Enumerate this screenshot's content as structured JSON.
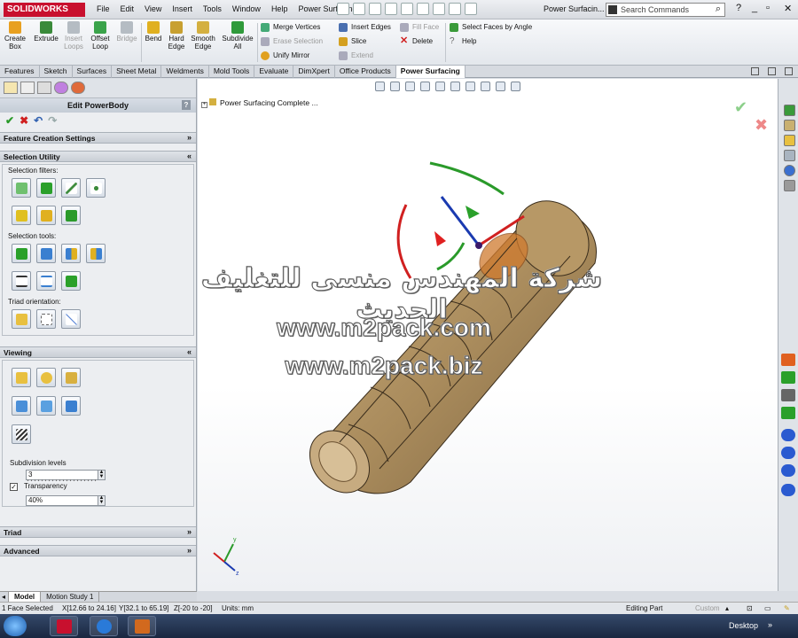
{
  "app": {
    "logo_text": "SOLIDWORKS",
    "document_title": "Power Surfacin..."
  },
  "menu": [
    "File",
    "Edit",
    "View",
    "Insert",
    "Tools",
    "Window",
    "Help",
    "Power Surfacing"
  ],
  "search": {
    "placeholder": "Search Commands"
  },
  "ribbon": {
    "large_buttons": [
      {
        "label1": "Create",
        "label2": "Box",
        "enabled": true,
        "color": "#e8a020"
      },
      {
        "label1": "Extrude",
        "label2": "",
        "enabled": true,
        "color": "#3a8a3a"
      },
      {
        "label1": "Insert",
        "label2": "Loops",
        "enabled": false,
        "color": "#9aa"
      },
      {
        "label1": "Offset",
        "label2": "Loop",
        "enabled": true,
        "color": "#3aa34a"
      },
      {
        "label1": "Bridge",
        "label2": "",
        "enabled": false,
        "color": "#9aa"
      },
      {
        "label1": "Bend",
        "label2": "",
        "enabled": true,
        "color": "#e0b020"
      },
      {
        "label1": "Hard",
        "label2": "Edge",
        "enabled": true,
        "color": "#c8a030"
      },
      {
        "label1": "Smooth",
        "label2": "Edge",
        "enabled": true,
        "color": "#d4b040"
      },
      {
        "label1": "Subdivide",
        "label2": "All",
        "enabled": true,
        "color": "#2f9a3a"
      }
    ],
    "small_buttons": [
      {
        "label": "Merge Vertices",
        "enabled": true,
        "color": "#4a7"
      },
      {
        "label": "Erase Selection",
        "enabled": false,
        "color": "#aab"
      },
      {
        "label": "Unify Mirror",
        "enabled": true,
        "color": "#e0a020"
      },
      {
        "label": "Insert Edges",
        "enabled": true,
        "color": "#4a6fb0"
      },
      {
        "label": "Slice",
        "enabled": true,
        "color": "#d4a020"
      },
      {
        "label": "Extend",
        "enabled": false,
        "color": "#aab"
      },
      {
        "label": "Fill Face",
        "enabled": false,
        "color": "#aab"
      },
      {
        "label": "Delete",
        "enabled": true,
        "color": "#d02020"
      },
      {
        "label": "Select Faces by Angle",
        "enabled": true,
        "color": "#3a9a3a"
      },
      {
        "label": "Help",
        "enabled": true,
        "color": "#888"
      }
    ]
  },
  "tabs": [
    {
      "label": "Features",
      "active": false
    },
    {
      "label": "Sketch",
      "active": false
    },
    {
      "label": "Surfaces",
      "active": false
    },
    {
      "label": "Sheet Metal",
      "active": false
    },
    {
      "label": "Weldments",
      "active": false
    },
    {
      "label": "Mold Tools",
      "active": false
    },
    {
      "label": "Evaluate",
      "active": false
    },
    {
      "label": "DimXpert",
      "active": false
    },
    {
      "label": "Office Products",
      "active": false
    },
    {
      "label": "Power Surfacing",
      "active": true
    }
  ],
  "property_manager": {
    "title": "Edit PowerBody",
    "help": "?",
    "ok": "✔",
    "cancel": "✖",
    "undo": "↶",
    "redo": "↷",
    "groups": {
      "feature_creation": {
        "title": "Feature Creation Settings",
        "chevron": "»"
      },
      "selection_utility": {
        "title": "Selection Utility",
        "chevron": "«",
        "filters_label": "Selection filters:",
        "tools_label": "Selection tools:",
        "triad_label": "Triad orientation:"
      },
      "viewing": {
        "title": "Viewing",
        "chevron": "«",
        "subdivision_label": "Subdivision levels",
        "subdivision_value": "3",
        "transparency_label": "Transparency",
        "transparency_checked": true,
        "transparency_value": "40%"
      },
      "triad": {
        "title": "Triad",
        "chevron": "»"
      },
      "advanced": {
        "title": "Advanced",
        "chevron": "»"
      }
    }
  },
  "viewport": {
    "tree_label": "Power Surfacing Complete ...",
    "confirm_ok": "✔",
    "confirm_cancel": "✖",
    "watermark": {
      "arabic": "شركة المهندس منسى للتغليف الحديث",
      "line1": "www.m2pack.com",
      "line2": "www.m2pack.biz"
    }
  },
  "model_tabs": [
    {
      "label": "Model",
      "active": true
    },
    {
      "label": "Motion Study 1",
      "active": false
    }
  ],
  "status_bar": {
    "selection": "1 Face Selected",
    "x_range": "X[12.66 to 24.16]",
    "y_range": "Y[32.1 to 65.19]",
    "z_range": "Z[-20 to -20]",
    "units": "Units: mm",
    "mode": "Editing Part",
    "custom": "Custom"
  },
  "taskbar": {
    "desktop": "Desktop"
  },
  "triad_axes": {
    "x": "x",
    "y": "y",
    "z": "z"
  }
}
